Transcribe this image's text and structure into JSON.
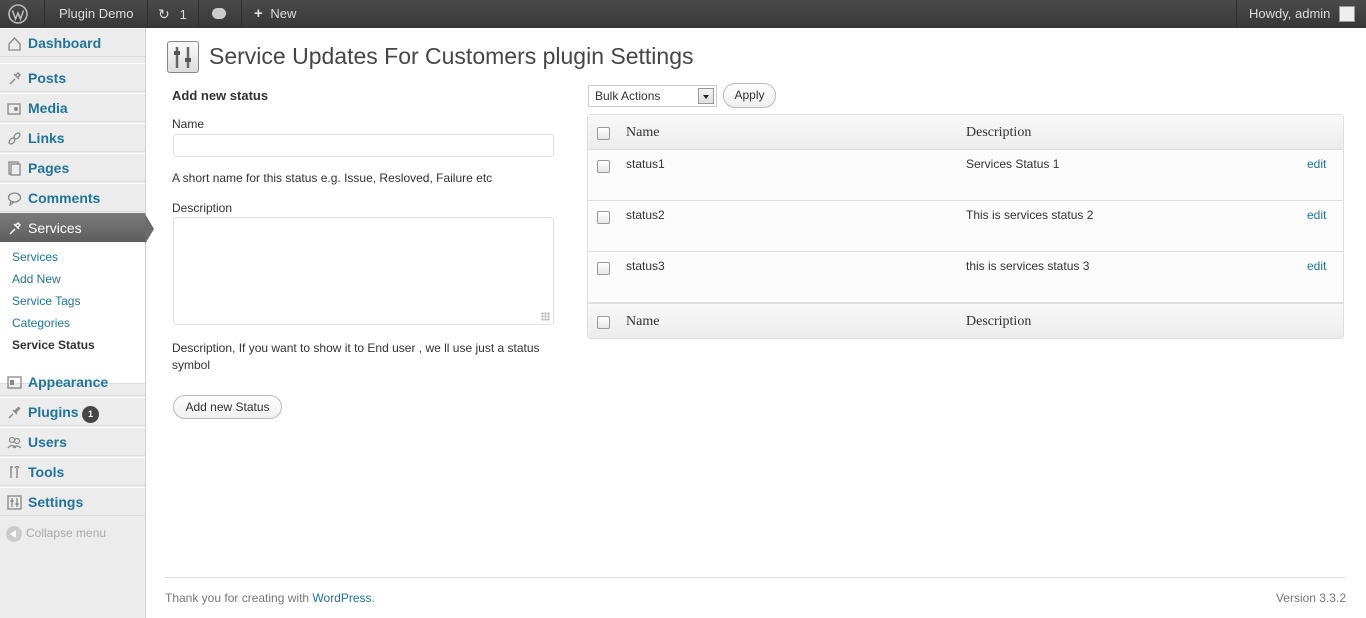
{
  "adminbar": {
    "site_name": "Plugin Demo",
    "updates_count": "1",
    "new_label": "New",
    "howdy": "Howdy, admin"
  },
  "sidebar": {
    "items": [
      {
        "label": "Dashboard",
        "icon": "dashboard-icon"
      },
      {
        "label": "Posts",
        "icon": "pin-icon"
      },
      {
        "label": "Media",
        "icon": "media-icon"
      },
      {
        "label": "Links",
        "icon": "link-icon"
      },
      {
        "label": "Pages",
        "icon": "pages-icon"
      },
      {
        "label": "Comments",
        "icon": "comment-icon"
      },
      {
        "label": "Services",
        "icon": "pin-icon"
      },
      {
        "label": "Appearance",
        "icon": "appearance-icon"
      },
      {
        "label": "Plugins",
        "icon": "plugin-icon",
        "badge": "1"
      },
      {
        "label": "Users",
        "icon": "users-icon"
      },
      {
        "label": "Tools",
        "icon": "tools-icon"
      },
      {
        "label": "Settings",
        "icon": "settings-icon"
      }
    ],
    "submenu": [
      "Services",
      "Add New",
      "Service Tags",
      "Categories",
      "Service Status"
    ],
    "collapse_label": "Collapse menu"
  },
  "page": {
    "title": "Service Updates For Customers plugin Settings"
  },
  "form": {
    "heading": "Add new status",
    "name_label": "Name",
    "name_value": "",
    "name_help": "A short name for this status e.g. Issue, Resloved, Failure etc",
    "description_label": "Description",
    "description_value": "",
    "description_help": "Description, If you want to show it to End user , we ll use just a status symbol",
    "submit_label": "Add new Status"
  },
  "list": {
    "bulk_actions": "Bulk Actions",
    "apply_label": "Apply",
    "columns": [
      "Name",
      "Description"
    ],
    "rows": [
      {
        "name": "status1",
        "description": "Services Status 1",
        "action": "edit"
      },
      {
        "name": "status2",
        "description": "This is services status 2",
        "action": "edit"
      },
      {
        "name": "status3",
        "description": "this is services status 3",
        "action": "edit"
      }
    ]
  },
  "footer": {
    "thanks_prefix": "Thank you for creating with ",
    "wordpress_link": "WordPress",
    "thanks_suffix": ".",
    "version": "Version 3.3.2"
  },
  "colors": {
    "link": "#21759b",
    "adminbar": "#464646",
    "current_menu": "#6a6a6a"
  }
}
